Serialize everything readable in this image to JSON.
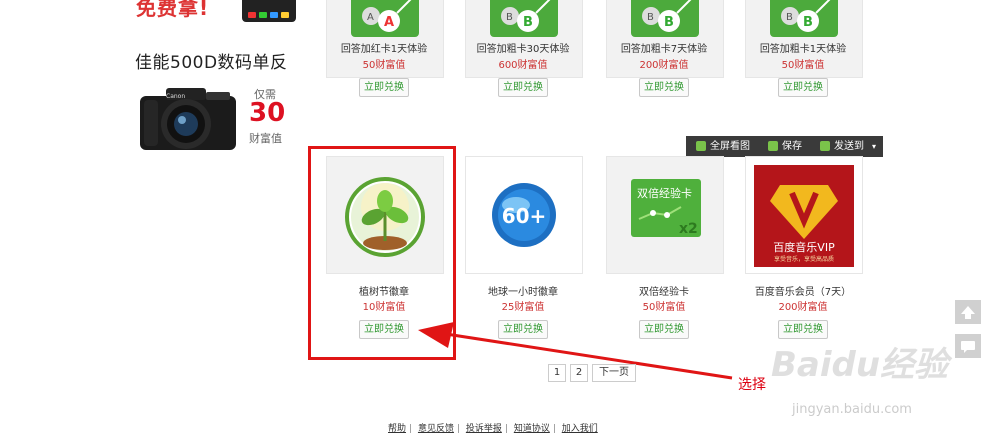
{
  "promo": {
    "top_text": "免费拿!"
  },
  "camera": {
    "title": "佳能500D数码单反",
    "price_label": "仅需",
    "price": "30",
    "price_unit": "财富值"
  },
  "products_row1": [
    {
      "name": "回答加红卡1天体验",
      "cost": "50财富值",
      "button": "立即兑换"
    },
    {
      "name": "回答加粗卡30天体验",
      "cost": "600财富值",
      "button": "立即兑换"
    },
    {
      "name": "回答加粗卡7天体验",
      "cost": "200财富值",
      "button": "立即兑换"
    },
    {
      "name": "回答加粗卡1天体验",
      "cost": "50财富值",
      "button": "立即兑换"
    }
  ],
  "products_row2": [
    {
      "name": "植树节徽章",
      "cost": "10财富值",
      "button": "立即兑换"
    },
    {
      "name": "地球一小时徽章",
      "cost": "25财富值",
      "button": "立即兑换"
    },
    {
      "name": "双倍经验卡",
      "cost": "50财富值",
      "button": "立即兑换",
      "card_title": "双倍经验卡",
      "card_badge": "x2"
    },
    {
      "name": "百度音乐会员（7天）",
      "cost": "200财富值",
      "button": "立即兑换",
      "card_title": "百度音乐VIP",
      "card_sub": "享受音乐，享受高品质"
    }
  ],
  "badges": {
    "earth_badge": "60+"
  },
  "toolbar": {
    "fullscreen": "全屏看图",
    "save": "保存",
    "send": "发送到"
  },
  "pager": {
    "page1": "1",
    "page2": "2",
    "next": "下一页"
  },
  "annotation": {
    "arrow_text": "选择"
  },
  "footer": {
    "links": [
      "帮助",
      "意见反馈",
      "投诉举报",
      "知道协议",
      "加入我们"
    ]
  },
  "watermark": {
    "logo": "Baidu经验",
    "url": "jingyan.baidu.com"
  },
  "colors": {
    "highlight": "#e01515",
    "cost": "#cc3333",
    "button_text": "#339933",
    "price": "#dd1122"
  }
}
